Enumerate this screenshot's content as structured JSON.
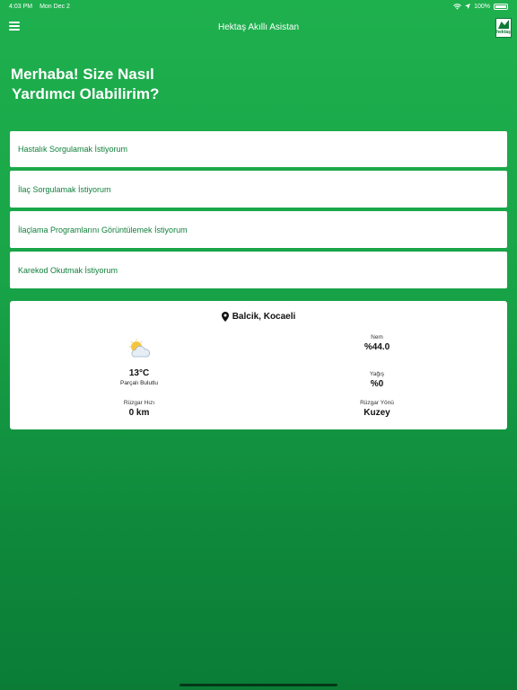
{
  "status": {
    "time": "4:03 PM",
    "date": "Mon Dec 2",
    "battery": "100%"
  },
  "nav": {
    "title": "Hektaş Akıllı Asistan",
    "logo_text": "hektaş"
  },
  "greeting": {
    "line1": "Merhaba! Size Nasıl",
    "line2": "Yardımcı Olabilirim?"
  },
  "menu": {
    "items": [
      {
        "label": "Hastalık Sorgulamak İstiyorum"
      },
      {
        "label": "İlaç Sorgulamak İstiyorum"
      },
      {
        "label": "İlaçlama Programlarını Görüntülemek İstiyorum"
      },
      {
        "label": "Karekod Okutmak İstiyorum"
      }
    ]
  },
  "weather": {
    "location": "Balcik, Kocaeli",
    "icon": "partly-cloudy-icon",
    "temperature": "13°C",
    "condition": "Parçalı Bulutlu",
    "humidity_label": "Nem",
    "humidity_value": "%44.0",
    "rain_label": "Yağış",
    "rain_value": "%0",
    "wind_speed_label": "Rüzgar Hızı",
    "wind_speed_value": "0 km",
    "wind_dir_label": "Rüzgar Yönü",
    "wind_dir_value": "Kuzey"
  },
  "colors": {
    "brand_green": "#1fb04e",
    "text_green": "#12803c"
  }
}
